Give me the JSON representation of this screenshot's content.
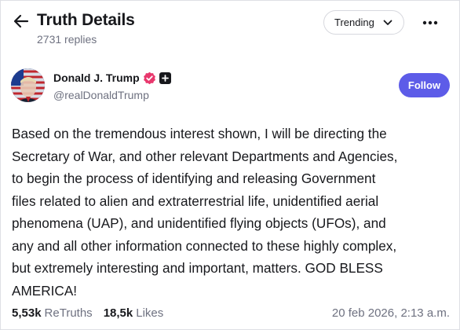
{
  "header": {
    "title": "Truth Details",
    "replies": "2731 replies",
    "sort_label": "Trending",
    "icons": {
      "back": "arrow-left-icon",
      "sort": "chevron-down-icon",
      "more": "more-horizontal-icon"
    }
  },
  "author": {
    "name": "Donald J. Trump",
    "handle": "@realDonaldTrump",
    "verified_color": "#e8386d",
    "follow_label": "Follow",
    "follow_color": "#5d5ce8"
  },
  "post": {
    "text": "Based on the tremendous interest shown, I will be directing the\nSecretary of War, and other relevant Departments and Agencies,\nto begin the process of identifying and releasing Government\nfiles related to alien and extraterrestrial life, unidentified aerial\nphenomena (UAP), and unidentified flying objects (UFOs), and\nany and all other information connected to these highly complex,\nbut extremely interesting and important, matters. GOD BLESS\nAMERICA!"
  },
  "stats": {
    "retruths_count": "5,53k",
    "retruths_label": "ReTruths",
    "likes_count": "18,5k",
    "likes_label": "Likes",
    "timestamp": "20 feb 2026, 2:13 a.m."
  }
}
